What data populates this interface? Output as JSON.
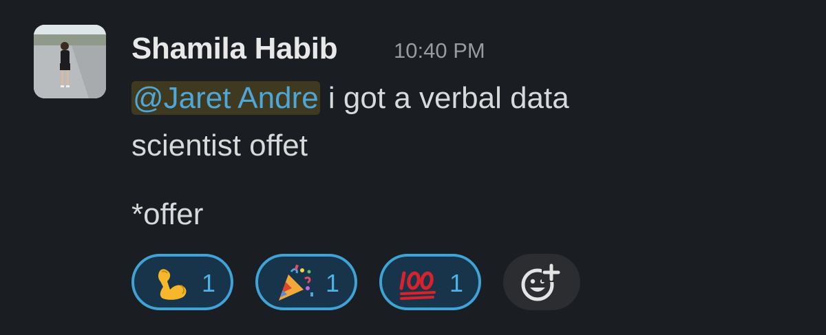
{
  "message": {
    "sender": "Shamila Habib",
    "timestamp": "10:40 PM",
    "mention": "@Jaret Andre",
    "text_after_mention": " i got a verbal data",
    "text_line2": "scientist offet",
    "correction": "*offer"
  },
  "reactions": [
    {
      "emoji": "flexed-biceps",
      "count": "1"
    },
    {
      "emoji": "party-popper",
      "count": "1"
    },
    {
      "emoji": "hundred-points",
      "count": "1"
    }
  ],
  "add_reaction_icon": "emoji-add-icon",
  "colors": {
    "background": "#1a1d21",
    "mention_bg": "#3f3a1f",
    "mention_text": "#4ea6d9",
    "reaction_border": "#3fa3d6",
    "reaction_bg": "#18344a"
  }
}
